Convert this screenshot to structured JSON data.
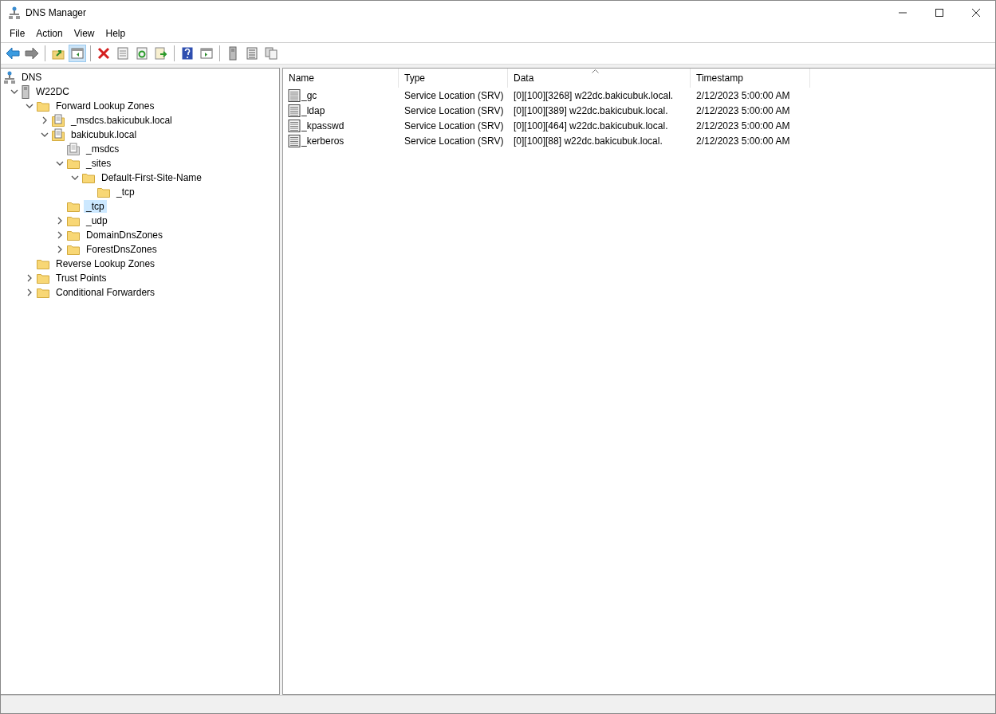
{
  "window": {
    "title": "DNS Manager"
  },
  "menu": [
    "File",
    "Action",
    "View",
    "Help"
  ],
  "toolbar": [
    [
      {
        "kind": "back",
        "pressed": false
      },
      {
        "kind": "forward",
        "pressed": false
      }
    ],
    [
      {
        "kind": "up",
        "pressed": false
      },
      {
        "kind": "tree",
        "pressed": true
      }
    ],
    [
      {
        "kind": "delete",
        "pressed": false
      },
      {
        "kind": "properties",
        "pressed": false
      },
      {
        "kind": "refresh",
        "pressed": false
      },
      {
        "kind": "export",
        "pressed": false
      }
    ],
    [
      {
        "kind": "help",
        "pressed": false
      },
      {
        "kind": "pane",
        "pressed": false
      }
    ],
    [
      {
        "kind": "server",
        "pressed": false
      },
      {
        "kind": "list",
        "pressed": false
      },
      {
        "kind": "copy",
        "pressed": false
      }
    ]
  ],
  "tree": [
    {
      "label": "DNS",
      "kind": "dns",
      "selected": false,
      "children": [
        {
          "label": "W22DC",
          "kind": "server",
          "expanded": true,
          "selected": false,
          "children": [
            {
              "label": "Forward Lookup Zones",
              "kind": "folder",
              "expanded": true,
              "selected": false,
              "children": [
                {
                  "label": "_msdcs.bakicubuk.local",
                  "kind": "zone",
                  "expanded": false,
                  "selected": false
                },
                {
                  "label": "bakicubuk.local",
                  "kind": "zone",
                  "expanded": true,
                  "selected": false,
                  "children": [
                    {
                      "label": "_msdcs",
                      "kind": "delegation",
                      "selected": false
                    },
                    {
                      "label": "_sites",
                      "kind": "folder",
                      "expanded": true,
                      "selected": false,
                      "children": [
                        {
                          "label": "Default-First-Site-Name",
                          "kind": "folder",
                          "expanded": true,
                          "selected": false,
                          "children": [
                            {
                              "label": "_tcp",
                              "kind": "folder",
                              "selected": false
                            }
                          ]
                        }
                      ]
                    },
                    {
                      "label": "_tcp",
                      "kind": "folder",
                      "selected": true
                    },
                    {
                      "label": "_udp",
                      "kind": "folder",
                      "expanded": false,
                      "selected": false
                    },
                    {
                      "label": "DomainDnsZones",
                      "kind": "folder",
                      "expanded": false,
                      "selected": false
                    },
                    {
                      "label": "ForestDnsZones",
                      "kind": "folder",
                      "expanded": false,
                      "selected": false
                    }
                  ]
                }
              ]
            },
            {
              "label": "Reverse Lookup Zones",
              "kind": "folder",
              "selected": false
            },
            {
              "label": "Trust Points",
              "kind": "folder",
              "expanded": false,
              "selected": false
            },
            {
              "label": "Conditional Forwarders",
              "kind": "folder",
              "expanded": false,
              "selected": false
            }
          ]
        }
      ]
    }
  ],
  "list": {
    "columns": [
      {
        "label": "Name",
        "sorted": false
      },
      {
        "label": "Type",
        "sorted": false
      },
      {
        "label": "Data",
        "sorted": true
      },
      {
        "label": "Timestamp",
        "sorted": false
      }
    ],
    "rows": [
      [
        "_gc",
        "Service Location (SRV)",
        "[0][100][3268] w22dc.bakicubuk.local.",
        "2/12/2023 5:00:00 AM"
      ],
      [
        "_ldap",
        "Service Location (SRV)",
        "[0][100][389] w22dc.bakicubuk.local.",
        "2/12/2023 5:00:00 AM"
      ],
      [
        "_kpasswd",
        "Service Location (SRV)",
        "[0][100][464] w22dc.bakicubuk.local.",
        "2/12/2023 5:00:00 AM"
      ],
      [
        "_kerberos",
        "Service Location (SRV)",
        "[0][100][88] w22dc.bakicubuk.local.",
        "2/12/2023 5:00:00 AM"
      ]
    ]
  }
}
